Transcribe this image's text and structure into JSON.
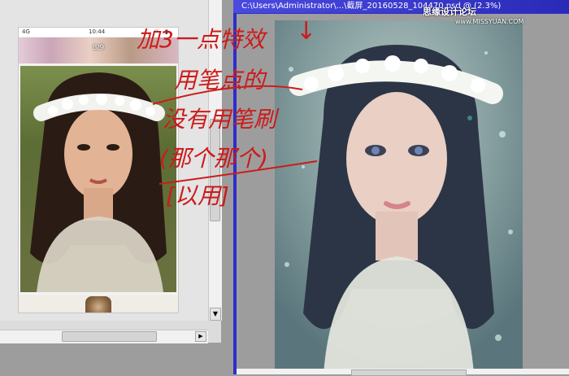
{
  "left_window": {
    "status_bar": {
      "signal": "4G",
      "time": "10:44"
    },
    "viewer": {
      "counter": "8/9"
    }
  },
  "right_window": {
    "title": "C:\\Users\\Administrator\\...\\截屏_20160528_104470.psd @ (2.3%)"
  },
  "watermark": {
    "text": "思缘设计论坛",
    "url": "www.MISSYUAN.COM"
  },
  "annotation": {
    "lines": [
      "加3一点特效",
      "用笔点的",
      "没有用笔刷",
      "(那个那个)",
      "[以用]"
    ],
    "color": "#cc1b1b"
  },
  "icons": {
    "scroll_down": "▼",
    "scroll_right": "▶",
    "arrow_down": "↓"
  }
}
